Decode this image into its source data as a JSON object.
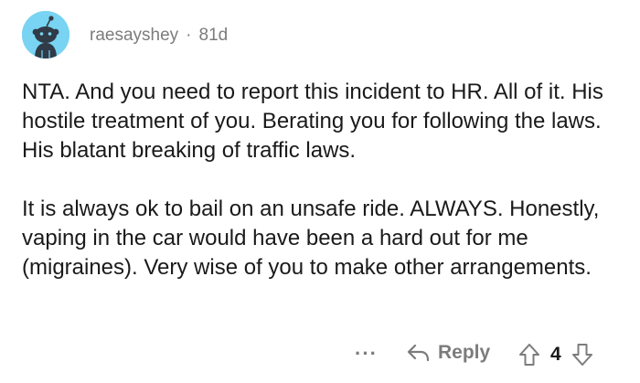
{
  "comment": {
    "username": "raesayshey",
    "separator": "·",
    "age": "81d",
    "paragraphs": [
      "NTA. And you need to report this incident to HR. All of it. His hostile treatment of you. Berating you for following the laws. His blatant breaking of traffic laws.",
      "It is always ok to bail on an unsafe ride. ALWAYS. Honestly, vaping in the car would have been a hard out for me (migraines). Very wise of you to make other arrangements."
    ],
    "avatar_icon": "snoo-avatar-icon",
    "avatar_color": "#79d3f2"
  },
  "actions": {
    "more_label": "···",
    "reply_label": "Reply",
    "reply_icon": "reply-arrow-icon",
    "upvote_icon": "upvote-arrow-icon",
    "downvote_icon": "downvote-arrow-icon",
    "score": "4"
  }
}
